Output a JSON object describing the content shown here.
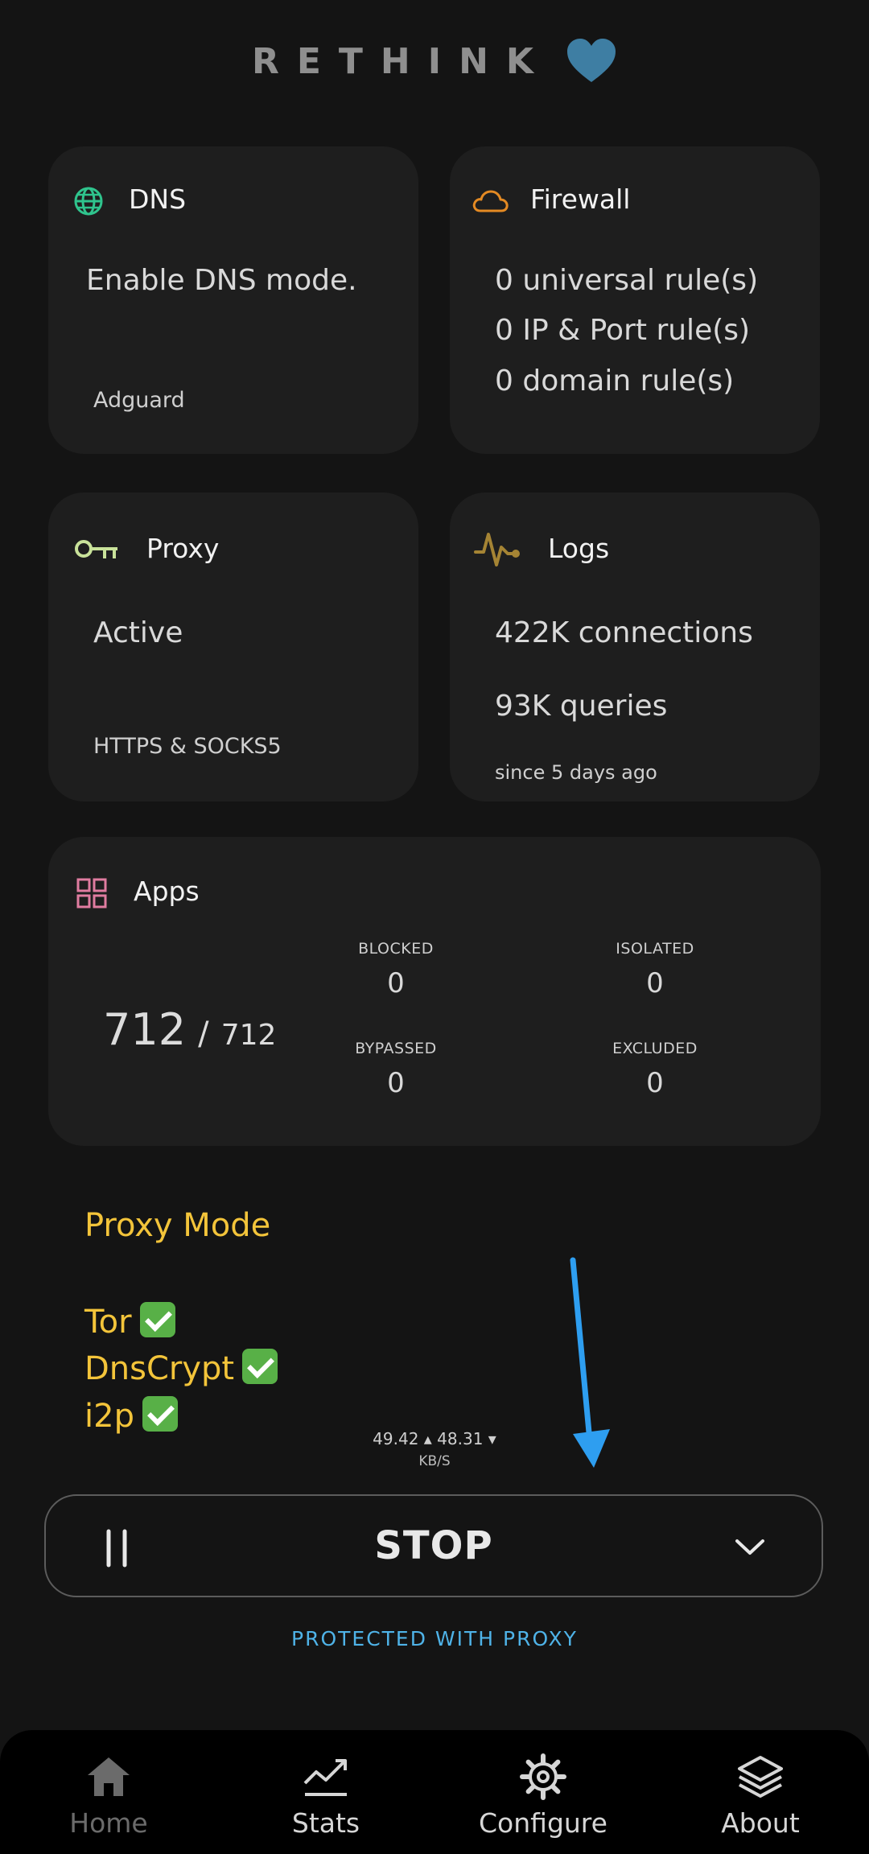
{
  "header": {
    "title": "RETHINK"
  },
  "cards": {
    "dns": {
      "title": "DNS",
      "status": "Enable DNS mode.",
      "provider": "Adguard"
    },
    "firewall": {
      "title": "Firewall",
      "rules": [
        "0 universal rule(s)",
        "0 IP & Port rule(s)",
        "0 domain rule(s)"
      ]
    },
    "proxy": {
      "title": "Proxy",
      "status": "Active",
      "type": "HTTPS & SOCKS5"
    },
    "logs": {
      "title": "Logs",
      "connections": "422K connections",
      "queries": "93K queries",
      "since": "since 5 days ago"
    },
    "apps": {
      "title": "Apps",
      "count": "712",
      "separator": "/",
      "total": "712",
      "blocked_label": "BLOCKED",
      "blocked_value": "0",
      "isolated_label": "ISOLATED",
      "isolated_value": "0",
      "bypassed_label": "BYPASSED",
      "bypassed_value": "0",
      "excluded_label": "EXCLUDED",
      "excluded_value": "0"
    }
  },
  "proxy_mode": {
    "title": "Proxy Mode",
    "items": [
      "Tor",
      "DnsCrypt",
      "i2p"
    ]
  },
  "speed": {
    "text": "49.42 ▴ 48.31 ▾",
    "unit": "KB/S"
  },
  "control": {
    "stop_label": "STOP",
    "status": "PROTECTED WITH PROXY"
  },
  "nav": [
    {
      "label": "Home",
      "icon": "home-icon"
    },
    {
      "label": "Stats",
      "icon": "stats-icon"
    },
    {
      "label": "Configure",
      "icon": "gear-icon"
    },
    {
      "label": "About",
      "icon": "layers-icon"
    }
  ],
  "colors": {
    "background": "#141414",
    "card": "#1e1e1e",
    "accent_yellow": "#f3c43a",
    "accent_blue": "#4fb3e8",
    "heart": "#3e7ea3",
    "arrow": "#2e9ef0"
  }
}
